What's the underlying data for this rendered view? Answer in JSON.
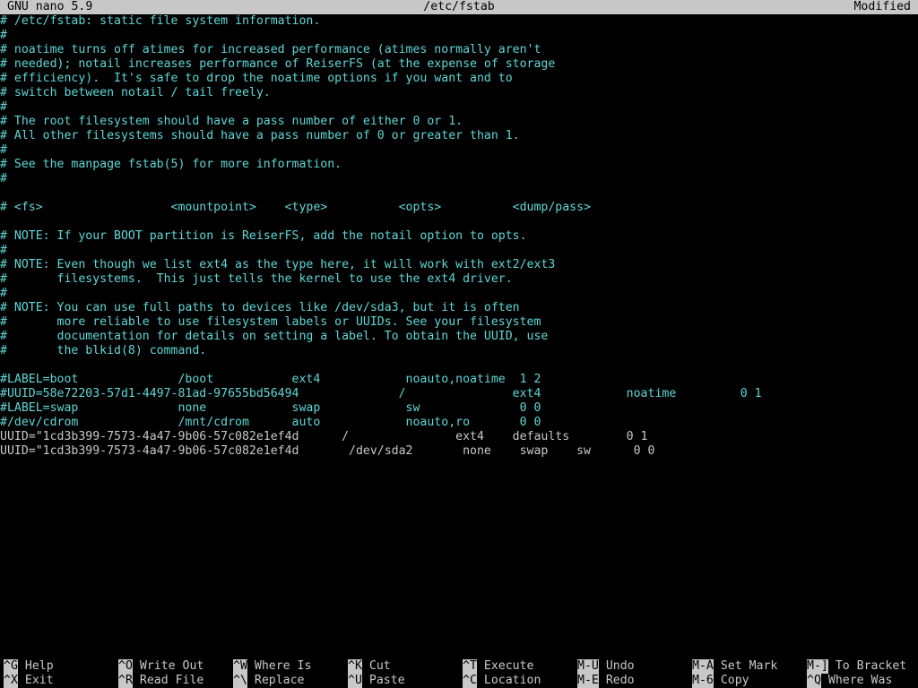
{
  "titlebar": {
    "app": "GNU nano 5.9",
    "filename": "/etc/fstab",
    "status": "Modified"
  },
  "editor": {
    "lines": [
      {
        "type": "comment",
        "text": "# /etc/fstab: static file system information."
      },
      {
        "type": "comment",
        "text": "#"
      },
      {
        "type": "comment",
        "text": "# noatime turns off atimes for increased performance (atimes normally aren't"
      },
      {
        "type": "comment",
        "text": "# needed); notail increases performance of ReiserFS (at the expense of storage"
      },
      {
        "type": "comment",
        "text": "# efficiency).  It's safe to drop the noatime options if you want and to"
      },
      {
        "type": "comment",
        "text": "# switch between notail / tail freely."
      },
      {
        "type": "comment",
        "text": "#"
      },
      {
        "type": "comment",
        "text": "# The root filesystem should have a pass number of either 0 or 1."
      },
      {
        "type": "comment",
        "text": "# All other filesystems should have a pass number of 0 or greater than 1."
      },
      {
        "type": "comment",
        "text": "#"
      },
      {
        "type": "comment",
        "text": "# See the manpage fstab(5) for more information."
      },
      {
        "type": "comment",
        "text": "#"
      },
      {
        "type": "blank",
        "text": ""
      },
      {
        "type": "comment",
        "text": "# <fs>                  <mountpoint>    <type>          <opts>          <dump/pass>"
      },
      {
        "type": "blank",
        "text": ""
      },
      {
        "type": "comment",
        "text": "# NOTE: If your BOOT partition is ReiserFS, add the notail option to opts."
      },
      {
        "type": "comment",
        "text": "#"
      },
      {
        "type": "comment",
        "text": "# NOTE: Even though we list ext4 as the type here, it will work with ext2/ext3"
      },
      {
        "type": "comment",
        "text": "#       filesystems.  This just tells the kernel to use the ext4 driver."
      },
      {
        "type": "comment",
        "text": "#"
      },
      {
        "type": "comment",
        "text": "# NOTE: You can use full paths to devices like /dev/sda3, but it is often"
      },
      {
        "type": "comment",
        "text": "#       more reliable to use filesystem labels or UUIDs. See your filesystem"
      },
      {
        "type": "comment",
        "text": "#       documentation for details on setting a label. To obtain the UUID, use"
      },
      {
        "type": "comment",
        "text": "#       the blkid(8) command."
      },
      {
        "type": "blank",
        "text": ""
      },
      {
        "type": "comment",
        "text": "#LABEL=boot              /boot           ext4            noauto,noatime  1 2"
      },
      {
        "type": "comment",
        "text": "#UUID=58e72203-57d1-4497-81ad-97655bd56494              /               ext4            noatime         0 1"
      },
      {
        "type": "comment",
        "text": "#LABEL=swap              none            swap            sw              0 0"
      },
      {
        "type": "comment",
        "text": "#/dev/cdrom              /mnt/cdrom      auto            noauto,ro       0 0"
      },
      {
        "type": "code",
        "text": "UUID=\"1cd3b399-7573-4a47-9b06-57c082e1ef4d      /               ext4    defaults        0 1"
      },
      {
        "type": "code",
        "text": "UUID=\"1cd3b399-7573-4a47-9b06-57c082e1ef4d       /dev/sda2       none    swap    sw      0 0"
      }
    ]
  },
  "shortcuts": {
    "row1": [
      {
        "key": "^G",
        "label": "Help"
      },
      {
        "key": "^O",
        "label": "Write Out"
      },
      {
        "key": "^W",
        "label": "Where Is"
      },
      {
        "key": "^K",
        "label": "Cut"
      },
      {
        "key": "^T",
        "label": "Execute"
      },
      {
        "key": "M-U",
        "label": "Undo"
      },
      {
        "key": "M-A",
        "label": "Set Mark"
      },
      {
        "key": "M-]",
        "label": "To Bracket"
      }
    ],
    "row2": [
      {
        "key": "^X",
        "label": "Exit"
      },
      {
        "key": "^R",
        "label": "Read File"
      },
      {
        "key": "^\\",
        "label": "Replace"
      },
      {
        "key": "^U",
        "label": "Paste"
      },
      {
        "key": "^C",
        "label": "Location"
      },
      {
        "key": "M-E",
        "label": "Redo"
      },
      {
        "key": "M-6",
        "label": "Copy"
      },
      {
        "key": "^Q",
        "label": "Where Was"
      }
    ]
  },
  "colors": {
    "comment": "#5fd7d7",
    "text": "#c8c8c8",
    "background": "#000000",
    "bar": "#c8c8c8"
  }
}
